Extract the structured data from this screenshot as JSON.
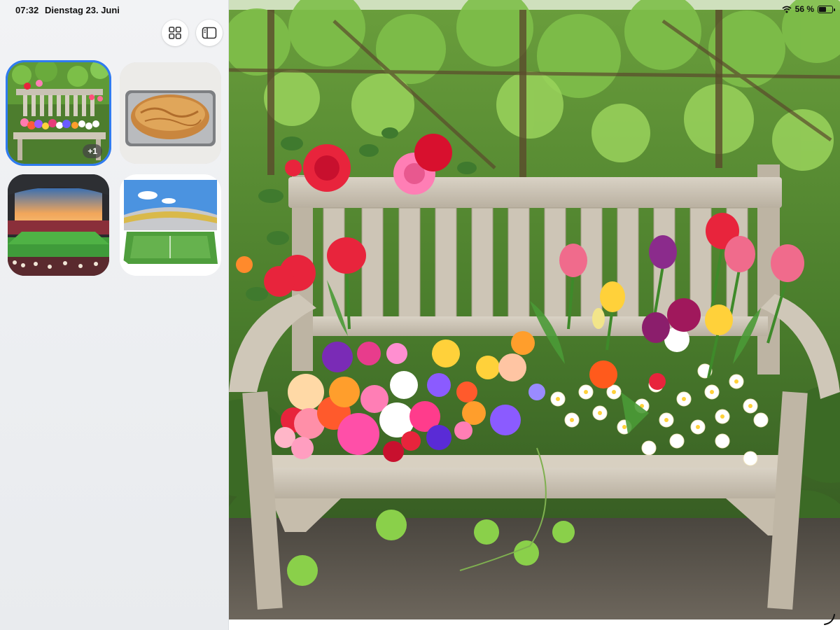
{
  "status_bar": {
    "time": "07:32",
    "date": "Dienstag 23. Juni",
    "battery_text": "56 %",
    "battery_level": 0.56
  },
  "toolbar": {
    "grid_icon": "grid-icon",
    "sidebar_icon": "sidebar-icon"
  },
  "gallery": {
    "items": [
      {
        "subject": "garden bench with flowers",
        "selected": true,
        "badge": "+1"
      },
      {
        "subject": "bread loaf in baking tin",
        "selected": false
      },
      {
        "subject": "stadium at sunset",
        "selected": false
      },
      {
        "subject": "stadium illustration",
        "selected": false
      }
    ]
  },
  "colors": {
    "selection_accent": "#2f7bf0",
    "sidebar_bg": "#eceef1"
  }
}
